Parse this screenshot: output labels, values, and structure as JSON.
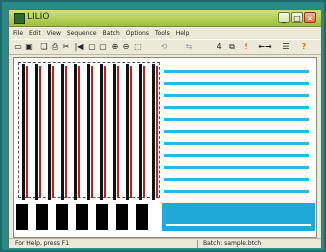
{
  "window": {
    "title": "LILIO"
  },
  "menubar": {
    "items": [
      "File",
      "Edit",
      "View",
      "Sequence",
      "Batch",
      "Options",
      "Tools",
      "Help"
    ]
  },
  "toolbar": {
    "tools": [
      {
        "icon": "new-icon",
        "glyph": "▭"
      },
      {
        "icon": "save-icon",
        "glyph": "▣"
      },
      {
        "icon": "open-icon",
        "glyph": "❑"
      },
      {
        "icon": "print-icon",
        "glyph": "⎙"
      },
      {
        "icon": "cut-icon",
        "glyph": "✂"
      },
      {
        "icon": "step-icon",
        "glyph": "|◀"
      },
      {
        "icon": "frame-icon",
        "glyph": "▢"
      },
      {
        "icon": "frame2-icon",
        "glyph": "▢"
      },
      {
        "icon": "zoom-in-icon",
        "glyph": "⊕"
      },
      {
        "icon": "zoom-out-icon",
        "glyph": "⊖"
      },
      {
        "icon": "select-icon",
        "glyph": "⬚"
      },
      {
        "icon": "rotate-icon",
        "glyph": "⟲"
      },
      {
        "icon": "flip-icon",
        "glyph": "⇆"
      },
      {
        "icon": "num-icon",
        "glyph": "4"
      },
      {
        "icon": "copy-icon",
        "glyph": "⧉"
      },
      {
        "icon": "alert-icon",
        "glyph": "!"
      },
      {
        "icon": "arrows-icon",
        "glyph": "←→"
      },
      {
        "icon": "sort-icon",
        "glyph": "☰"
      },
      {
        "icon": "help-icon",
        "glyph": "?"
      }
    ]
  },
  "status": {
    "left": "For Help, press F1",
    "right": "Batch: sample.btch"
  },
  "colors": {
    "accent_cyan": "#1fa9d8",
    "line_red": "#c21d1d",
    "title_green": "#b7d157"
  }
}
